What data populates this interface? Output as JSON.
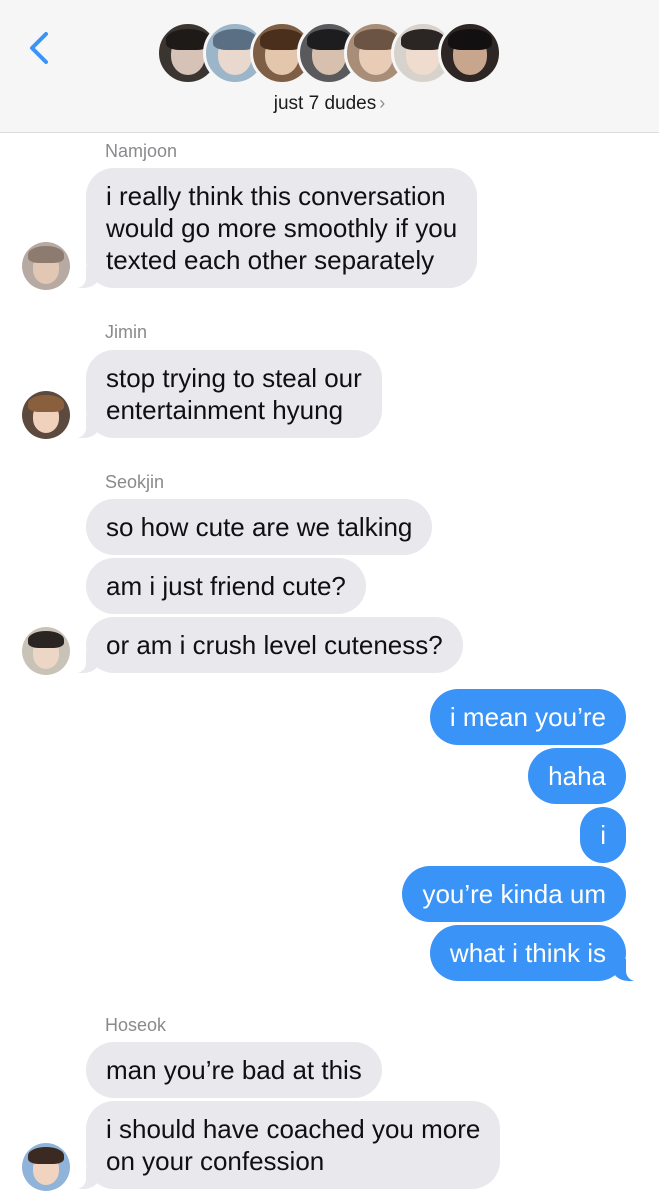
{
  "header": {
    "back_icon": "chevron-left-icon",
    "group_name": "just 7 dudes",
    "group_chevron": "›",
    "accent": "#3a93f6",
    "member_avatars": [
      {
        "bg": "#3b3532",
        "skin": "#e8d2c4",
        "hair": "#1e1a18"
      },
      {
        "bg": "#9cb5c9",
        "skin": "#f1dccd",
        "hair": "#5a6f84"
      },
      {
        "bg": "#7e5e44",
        "skin": "#f0d2b8",
        "hair": "#4a2f1c"
      },
      {
        "bg": "#5a5a5c",
        "skin": "#e6cbb7",
        "hair": "#1d1d1f"
      },
      {
        "bg": "#a88d78",
        "skin": "#efd3bd",
        "hair": "#6b5443"
      },
      {
        "bg": "#d8d2cc",
        "skin": "#f2ddcf",
        "hair": "#2b2623"
      },
      {
        "bg": "#2e2624",
        "skin": "#d9b59a",
        "hair": "#121010"
      }
    ]
  },
  "messages": {
    "namjoon": {
      "name": "Namjoon",
      "avatar": {
        "bg": "#b7aaa2",
        "skin": "#e2c7b4",
        "hair": "#8d7b70"
      },
      "lines": [
        "i really think this conversation",
        "would go more smoothly if you",
        "texted each other separately"
      ]
    },
    "jimin": {
      "name": "Jimin",
      "avatar": {
        "bg": "#5d4a3f",
        "skin": "#efd1bc",
        "hair": "#8a5f3e"
      },
      "lines": [
        "stop trying to steal our",
        "entertainment hyung"
      ]
    },
    "seokjin": {
      "name": "Seokjin",
      "avatar": {
        "bg": "#c9c2b7",
        "skin": "#ecd6c6",
        "hair": "#2a2522"
      },
      "bubbles": [
        "so how cute are we talking",
        "am i just friend cute?",
        "or am i crush level cuteness?"
      ]
    },
    "me": {
      "bubbles": [
        "i mean you’re",
        "haha",
        "i",
        "you’re kinda um",
        "what i think is"
      ]
    },
    "hoseok": {
      "name": "Hoseok",
      "avatar": {
        "bg": "#8fb3d9",
        "skin": "#f0d4c0",
        "hair": "#3a2a22"
      },
      "bubble1": "man you’re bad at this",
      "lines": [
        "i should have coached you more",
        "on your confession"
      ]
    }
  }
}
